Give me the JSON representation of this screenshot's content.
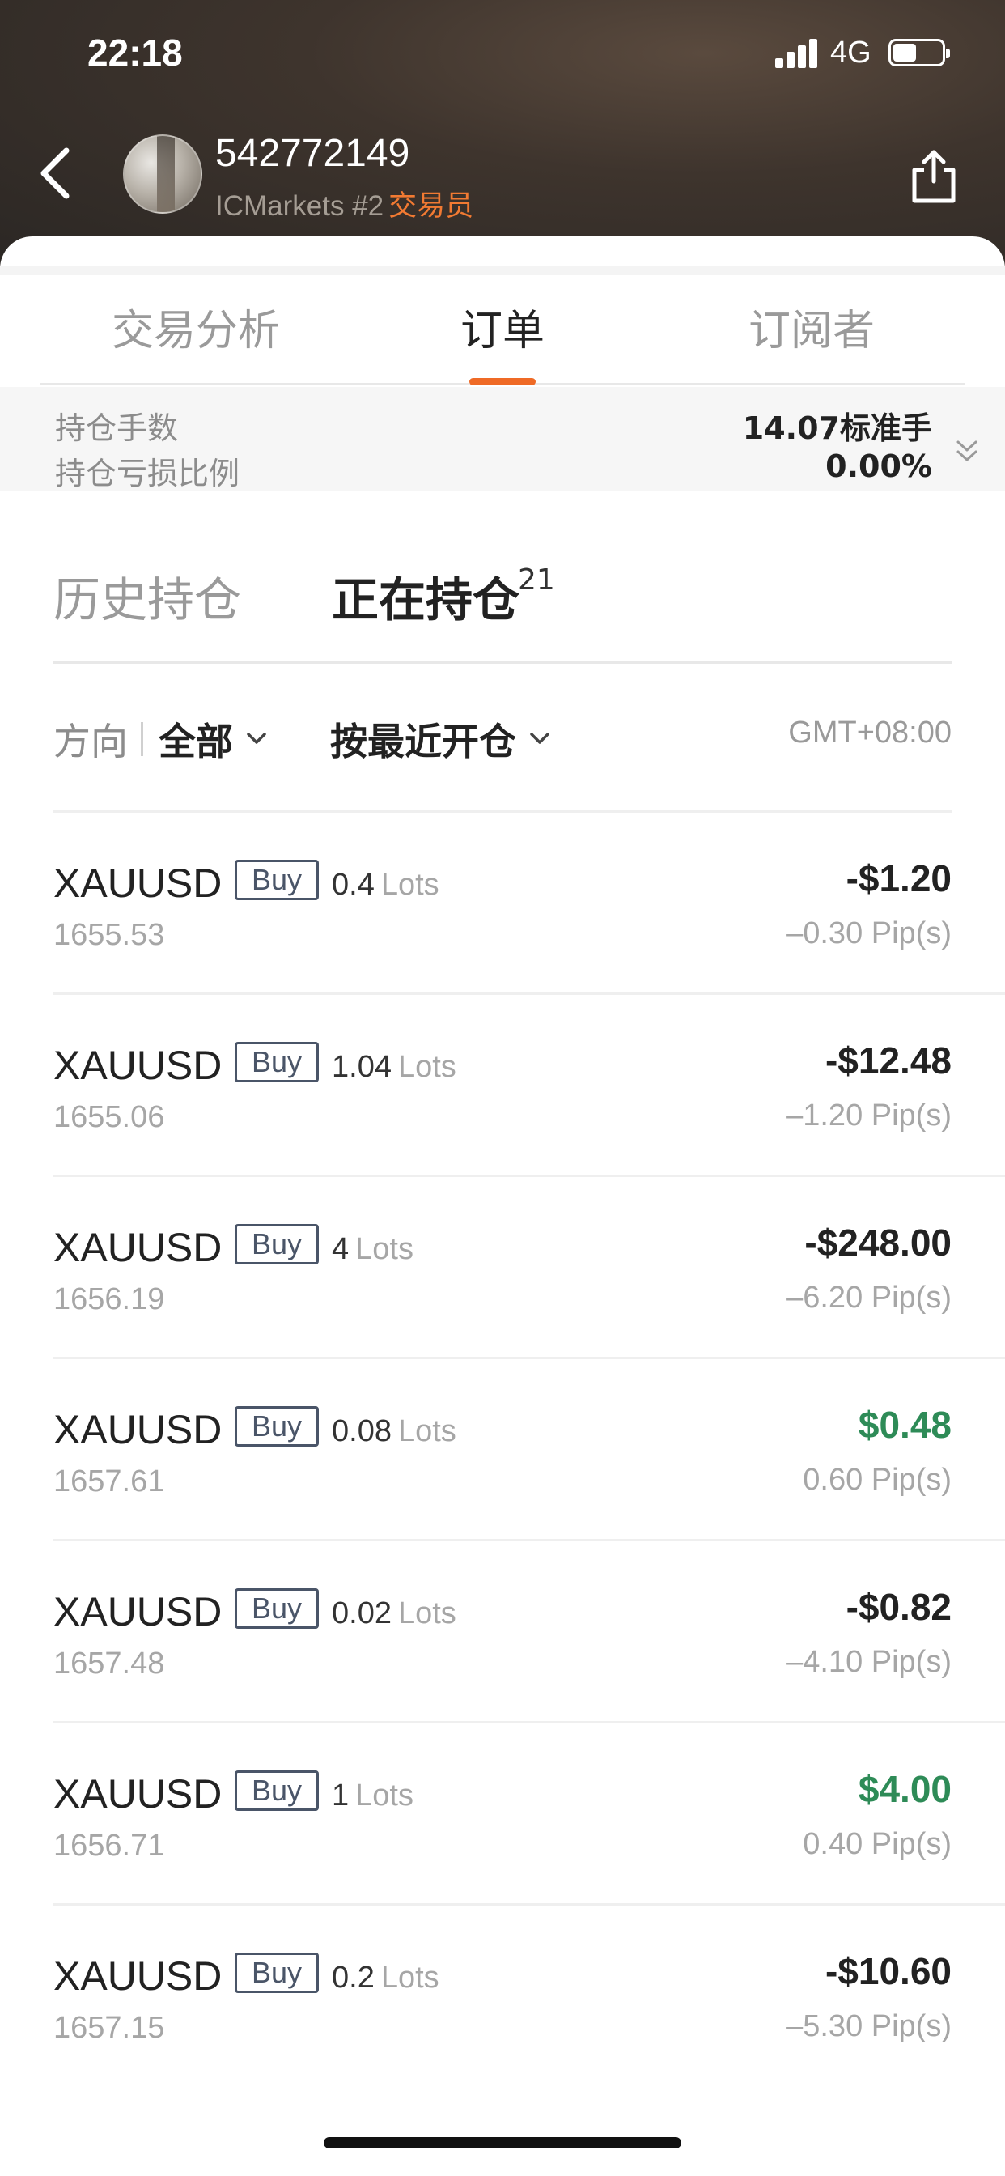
{
  "status_bar": {
    "time": "22:18",
    "network": "4G"
  },
  "header": {
    "user_id": "542772149",
    "broker": "ICMarkets #2",
    "role": "交易员",
    "back_icon": "chevron-left-icon",
    "share_icon": "share-icon"
  },
  "tabs": [
    {
      "label": "交易分析",
      "active": false
    },
    {
      "label": "订单",
      "active": true
    },
    {
      "label": "订阅者",
      "active": false
    }
  ],
  "summary": {
    "lots_label": "持仓手数",
    "lots_value": "14.07标准手",
    "ratio_label": "持仓亏损比例",
    "ratio_value": "0.00%"
  },
  "position_tabs": {
    "history": "历史持仓",
    "open": "正在持仓",
    "open_count": "21"
  },
  "filters": {
    "direction_label": "方向",
    "direction_value": "全部",
    "sort_value": "按最近开仓",
    "timezone": "GMT+08:00"
  },
  "colors": {
    "accent": "#ef6a26",
    "gain": "#2e8b57",
    "loss": "#222222"
  },
  "orders": [
    {
      "symbol": "XAUUSD",
      "side": "Buy",
      "lots": "0.4",
      "lots_unit": "Lots",
      "open_price": "1655.53",
      "pnl": "-$1.20",
      "pips": "–0.30 Pip(s)",
      "trend": "loss"
    },
    {
      "symbol": "XAUUSD",
      "side": "Buy",
      "lots": "1.04",
      "lots_unit": "Lots",
      "open_price": "1655.06",
      "pnl": "-$12.48",
      "pips": "–1.20 Pip(s)",
      "trend": "loss"
    },
    {
      "symbol": "XAUUSD",
      "side": "Buy",
      "lots": "4",
      "lots_unit": "Lots",
      "open_price": "1656.19",
      "pnl": "-$248.00",
      "pips": "–6.20 Pip(s)",
      "trend": "loss"
    },
    {
      "symbol": "XAUUSD",
      "side": "Buy",
      "lots": "0.08",
      "lots_unit": "Lots",
      "open_price": "1657.61",
      "pnl": "$0.48",
      "pips": "0.60 Pip(s)",
      "trend": "gain"
    },
    {
      "symbol": "XAUUSD",
      "side": "Buy",
      "lots": "0.02",
      "lots_unit": "Lots",
      "open_price": "1657.48",
      "pnl": "-$0.82",
      "pips": "–4.10 Pip(s)",
      "trend": "loss"
    },
    {
      "symbol": "XAUUSD",
      "side": "Buy",
      "lots": "1",
      "lots_unit": "Lots",
      "open_price": "1656.71",
      "pnl": "$4.00",
      "pips": "0.40 Pip(s)",
      "trend": "gain"
    },
    {
      "symbol": "XAUUSD",
      "side": "Buy",
      "lots": "0.2",
      "lots_unit": "Lots",
      "open_price": "1657.15",
      "pnl": "-$10.60",
      "pips": "–5.30 Pip(s)",
      "trend": "loss"
    }
  ]
}
